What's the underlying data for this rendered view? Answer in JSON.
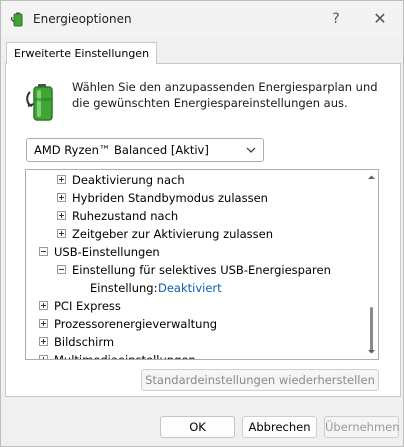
{
  "window": {
    "title": "Energieoptionen",
    "help_glyph": "?",
    "close_glyph": "✕"
  },
  "tab": {
    "label": "Erweiterte Einstellungen"
  },
  "description": "Wählen Sie den anzupassenden Energiesparplan und die gewünschten Energiespareinstellungen aus.",
  "plan_select": {
    "value": "AMD Ryzen™ Balanced [Aktiv]"
  },
  "tree": {
    "rows": [
      {
        "label": "Deaktivierung nach"
      },
      {
        "label": "Hybriden Standbymodus zulassen"
      },
      {
        "label": "Ruhezustand nach"
      },
      {
        "label": "Zeitgeber zur Aktivierung zulassen"
      },
      {
        "label": "USB-Einstellungen"
      },
      {
        "label": "Einstellung für selektives USB-Energiesparen"
      },
      {
        "label": "Einstellung:",
        "value": "Deaktiviert"
      },
      {
        "label": "PCI Express"
      },
      {
        "label": "Prozessorenergieverwaltung"
      },
      {
        "label": "Bildschirm"
      },
      {
        "label": "Multimediaeinstellungen"
      }
    ]
  },
  "buttons": {
    "restore": "Standardeinstellungen wiederherstellen",
    "ok": "OK",
    "cancel": "Abbrechen",
    "apply": "Übernehmen"
  },
  "colors": {
    "link": "#0b5fad",
    "battery_green": "#3fa535"
  }
}
